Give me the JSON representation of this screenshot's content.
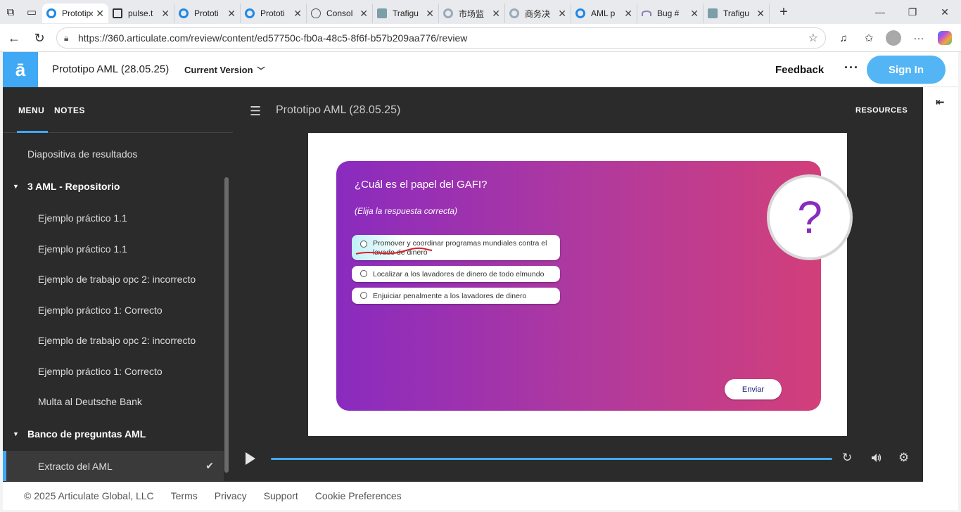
{
  "browser": {
    "tabs": [
      {
        "label": "Prototipo AML",
        "icon": "ring",
        "active": true
      },
      {
        "label": "pulse.t",
        "icon": "doc"
      },
      {
        "label": "Prototi",
        "icon": "ring"
      },
      {
        "label": "Prototi",
        "icon": "ring"
      },
      {
        "label": "Consol",
        "icon": "globe"
      },
      {
        "label": "Trafigu",
        "icon": "share"
      },
      {
        "label": "市场监",
        "icon": "gray"
      },
      {
        "label": "商务决",
        "icon": "gray"
      },
      {
        "label": "AML p",
        "icon": "ring"
      },
      {
        "label": "Bug #",
        "icon": "arc"
      },
      {
        "label": "Trafigu",
        "icon": "share"
      }
    ],
    "url": "https://360.articulate.com/review/content/ed57750c-fb0a-48c5-8f6f-b57b209aa776/review"
  },
  "header": {
    "logo": "ā",
    "title": "Prototipo AML (28.05.25)",
    "version": "Current Version",
    "feedback": "Feedback",
    "more": "···",
    "signin": "Sign In"
  },
  "sidebar": {
    "tab_menu": "MENU",
    "tab_notes": "NOTES",
    "items": [
      {
        "label": "Diapositiva de resultados",
        "type": "item",
        "indent": 1
      },
      {
        "label": "3 AML - Repositorio",
        "type": "section"
      },
      {
        "label": "Ejemplo práctico 1.1",
        "type": "item",
        "indent": 2
      },
      {
        "label": "Ejemplo práctico 1.1",
        "type": "item",
        "indent": 2
      },
      {
        "label": "Ejemplo de trabajo opc 2: incorrecto",
        "type": "item",
        "indent": 2
      },
      {
        "label": "Ejemplo práctico 1: Correcto",
        "type": "item",
        "indent": 2
      },
      {
        "label": "Ejemplo de trabajo opc 2: incorrecto",
        "type": "item",
        "indent": 2
      },
      {
        "label": "Ejemplo práctico 1: Correcto",
        "type": "item",
        "indent": 2
      },
      {
        "label": "Multa al Deutsche Bank",
        "type": "item",
        "indent": 2
      },
      {
        "label": "Banco de preguntas AML",
        "type": "section"
      },
      {
        "label": "Extracto del AML",
        "type": "item",
        "indent": 2,
        "active": true,
        "checked": true
      }
    ]
  },
  "player": {
    "title": "Prototipo AML (28.05.25)",
    "resources": "RESOURCES",
    "slide": {
      "question": "¿Cuál es el papel del GAFI?",
      "instruction": "(Elija la respuesta correcta)",
      "options": [
        "Promover y coordinar programas mundiales contra el lavado de dinero",
        "Localizar a los lavadores de dinero de todo elmundo",
        "Enjuiciar penalmente a los lavadores de dinero"
      ],
      "question_mark": "?",
      "submit": "Enviar"
    }
  },
  "footer": {
    "copyright": "© 2025 Articulate Global, LLC",
    "terms": "Terms",
    "privacy": "Privacy",
    "support": "Support",
    "cookies": "Cookie Preferences"
  },
  "colors": {
    "accent": "#3fa9f5",
    "card_start": "#8a2bbf",
    "card_end": "#d23f7a"
  }
}
